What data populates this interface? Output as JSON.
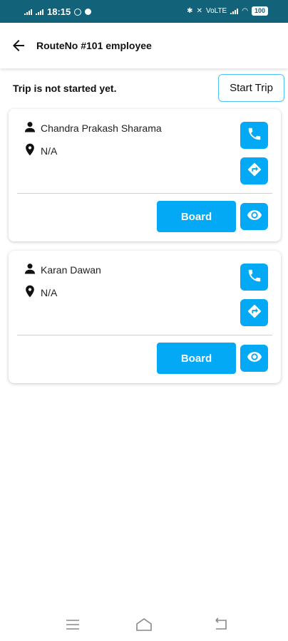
{
  "status_bar": {
    "time": "18:15",
    "network_label": "VoLTE",
    "battery": "100"
  },
  "app_bar": {
    "title": "RouteNo #101 employee",
    "back_icon": "arrow-left-icon"
  },
  "trip": {
    "status_text": "Trip is not started yet.",
    "start_label": "Start Trip"
  },
  "employees": [
    {
      "name": "Chandra Prakash Sharama",
      "location": "N/A",
      "board_label": "Board"
    },
    {
      "name": "Karan Dawan",
      "location": "N/A",
      "board_label": "Board"
    }
  ],
  "icons": {
    "person": "person-icon",
    "location": "location-pin-icon",
    "call": "phone-icon",
    "directions": "directions-icon",
    "view": "eye-icon"
  },
  "colors": {
    "accent": "#03a9f4",
    "status_bar": "#12627a",
    "start_trip_border": "#4fc3f7"
  }
}
